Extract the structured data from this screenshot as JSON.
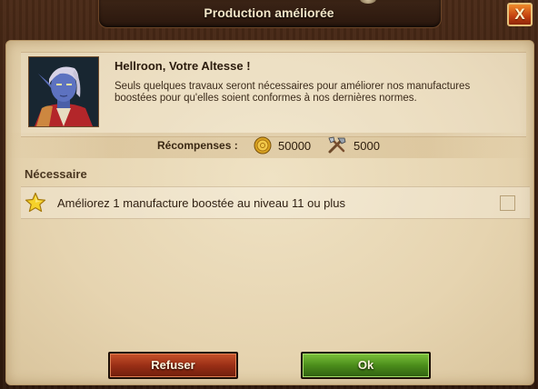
{
  "dialog": {
    "title": "Production améliorée",
    "close_label": "X"
  },
  "intro": {
    "speaker": "Hellroon, Votre Altesse !",
    "message": "Seuls quelques travaux seront nécessaires pour améliorer nos manufactures boostées pour qu'elles soient conformes à nos dernières normes."
  },
  "rewards": {
    "label": "Récompenses :",
    "items": [
      {
        "icon": "coin-icon",
        "value": "50000"
      },
      {
        "icon": "tools-icon",
        "value": "5000"
      }
    ]
  },
  "requirements": {
    "title": "Nécessaire",
    "tasks": [
      {
        "icon": "star-icon",
        "text": "Améliorez 1 manufacture boostée au niveau 11 ou plus",
        "done": false
      }
    ]
  },
  "buttons": {
    "refuse": "Refuser",
    "ok": "Ok"
  },
  "colors": {
    "refuse": "#9a2f16",
    "ok": "#4b8d1b",
    "parchment": "#e6d4b0"
  }
}
